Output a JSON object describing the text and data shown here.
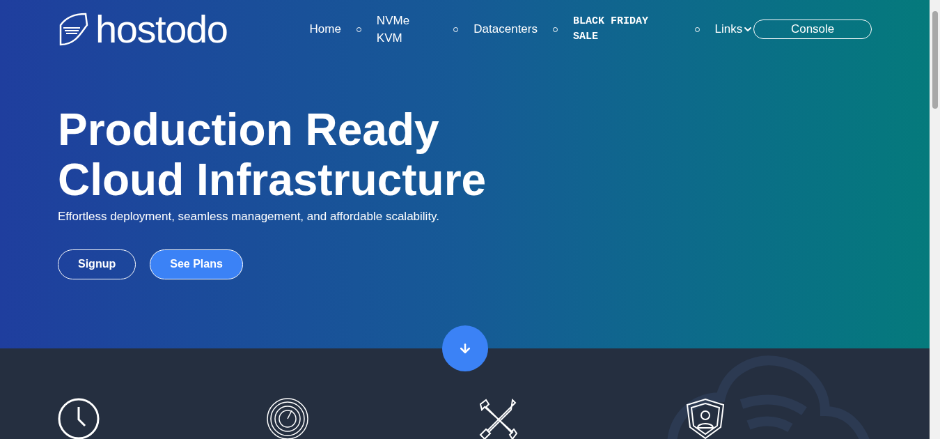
{
  "logo": {
    "text": "hostodo"
  },
  "nav": [
    {
      "label": "Home",
      "kind": "link"
    },
    {
      "label": "NVMe KVM",
      "kind": "link"
    },
    {
      "label": "Datacenters",
      "kind": "link"
    },
    {
      "label": "BLACK FRIDAY SALE",
      "kind": "promo"
    },
    {
      "label": "Links",
      "kind": "dropdown"
    }
  ],
  "console_button": "Console",
  "hero": {
    "title_lines": [
      "Production Ready",
      "Cloud Infrastructure"
    ],
    "subtitle": "Effortless deployment, seamless management, and affordable scalability.",
    "buttons": [
      {
        "label": "Signup",
        "kind": "outline"
      },
      {
        "label": "See Plans",
        "kind": "filled"
      }
    ]
  },
  "features": [
    {
      "kind": "clock"
    },
    {
      "kind": "gauge"
    },
    {
      "kind": "tools"
    },
    {
      "kind": "shield"
    }
  ]
}
